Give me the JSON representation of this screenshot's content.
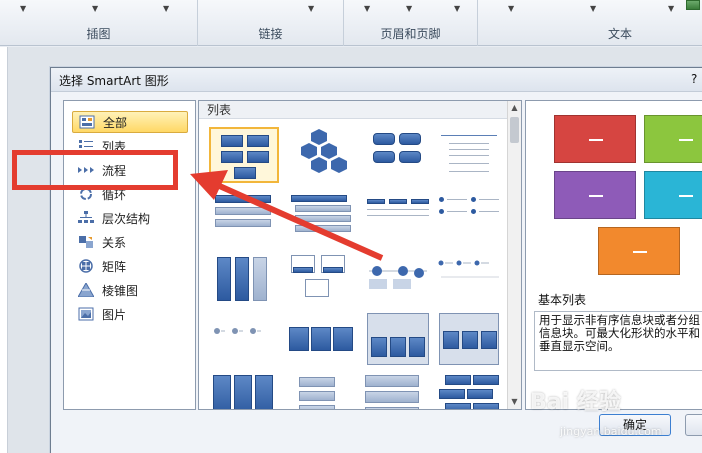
{
  "ribbon": {
    "groups": [
      {
        "label": "插图"
      },
      {
        "label": "链接"
      },
      {
        "label": "页眉和页脚"
      },
      {
        "label": "文本"
      }
    ]
  },
  "dialog": {
    "title": "选择 SmartArt 图形",
    "help": "?",
    "categories": [
      {
        "label": "全部",
        "icon": "all-grid-icon",
        "selected": true
      },
      {
        "label": "列表",
        "icon": "list-icon"
      },
      {
        "label": "流程",
        "icon": "process-arrows-icon"
      },
      {
        "label": "循环",
        "icon": "cycle-icon"
      },
      {
        "label": "层次结构",
        "icon": "hierarchy-icon"
      },
      {
        "label": "关系",
        "icon": "relationship-icon"
      },
      {
        "label": "矩阵",
        "icon": "matrix-icon"
      },
      {
        "label": "棱锥图",
        "icon": "pyramid-icon"
      },
      {
        "label": "图片",
        "icon": "picture-icon"
      }
    ],
    "gallery_header": "列表",
    "preview": {
      "colors": [
        "#d64541",
        "#8cc63e",
        "#8e5bb8",
        "#2ab5d6",
        "#f2892d"
      ],
      "title": "基本列表",
      "description": "用于显示非有序信息块或者分组信息块。可最大化形状的水平和垂直显示空间。"
    },
    "ok_label": "确定"
  },
  "watermark": {
    "text": "Bai 经验",
    "sub": "jingyan.baidu.com"
  },
  "colors": {
    "annotation_red": "#e43c2f",
    "selection_gold": "#ffd866"
  }
}
